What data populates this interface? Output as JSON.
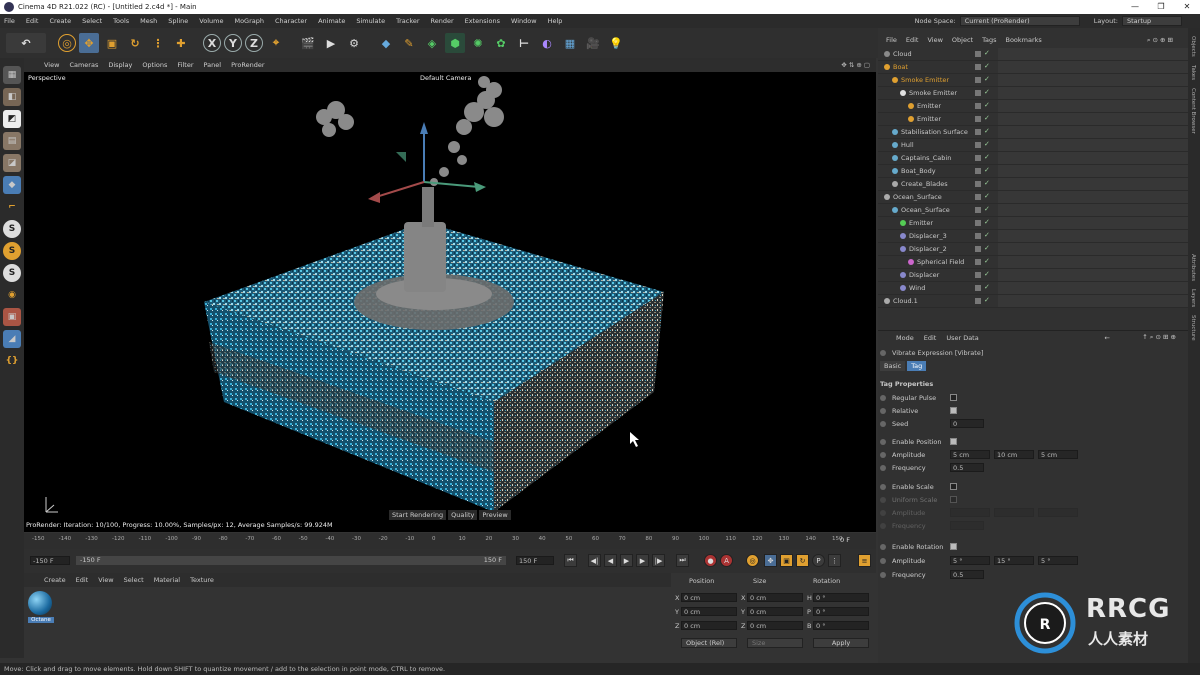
{
  "app": {
    "title": "Cinema 4D R21.022 (RC) - [Untitled 2.c4d *] - Main",
    "window_controls": [
      "—",
      "❐",
      "✕"
    ]
  },
  "menubar": {
    "items": [
      "File",
      "Edit",
      "Create",
      "Select",
      "Tools",
      "Mesh",
      "Spline",
      "Volume",
      "MoGraph",
      "Character",
      "Animate",
      "Simulate",
      "Tracker",
      "Render",
      "Extensions",
      "Window",
      "Help"
    ],
    "node_space_label": "Node Space:",
    "node_space_value": "Current (ProRender)",
    "layout_label": "Layout:",
    "layout_value": "Startup"
  },
  "toolbar": {
    "axis_labels": [
      "X",
      "Y",
      "Z"
    ]
  },
  "viewport": {
    "menu": [
      "View",
      "Cameras",
      "Display",
      "Options",
      "Filter",
      "Panel",
      "ProRender"
    ],
    "label": "Perspective",
    "camera": "Default Camera",
    "status": "ProRender: Iteration: 10/100, Progress: 10.00%, Samples/px: 12, Average Samples/s: 99.924M",
    "buttons": [
      "Start Rendering",
      "Quality",
      "Preview"
    ]
  },
  "timeline": {
    "ticks": [
      "-150",
      "-140",
      "-130",
      "-120",
      "-110",
      "-100",
      "-90",
      "-80",
      "-70",
      "-60",
      "-50",
      "-40",
      "-30",
      "-20",
      "-10",
      "0",
      "10",
      "20",
      "30",
      "40",
      "50",
      "60",
      "70",
      "80",
      "90",
      "100",
      "110",
      "120",
      "130",
      "140",
      "150"
    ],
    "frame_indicator": "0 F",
    "start_field": "-150 F",
    "range_start": "-150 F",
    "range_end": "150 F",
    "end_field": "150 F"
  },
  "material_manager": {
    "menu": [
      "Create",
      "Edit",
      "View",
      "Select",
      "Material",
      "Texture"
    ],
    "material_name": "Octane"
  },
  "coordinates": {
    "headers": [
      "Position",
      "Size",
      "Rotation"
    ],
    "rows": [
      {
        "axis": "X",
        "pos": "0 cm",
        "size_axis": "X",
        "size": "0 cm",
        "rot_axis": "H",
        "rot": "0 °"
      },
      {
        "axis": "Y",
        "pos": "0 cm",
        "size_axis": "Y",
        "size": "0 cm",
        "rot_axis": "P",
        "rot": "0 °"
      },
      {
        "axis": "Z",
        "pos": "0 cm",
        "size_axis": "Z",
        "size": "0 cm",
        "rot_axis": "B",
        "rot": "0 °"
      }
    ],
    "mode": "Object (Rel)",
    "size_mode": "Size",
    "apply": "Apply"
  },
  "object_manager": {
    "menu": [
      "File",
      "Edit",
      "View",
      "Object",
      "Tags",
      "Bookmarks"
    ],
    "objects": [
      {
        "name": "Cloud",
        "indent": 0,
        "color": "#8a8a8a"
      },
      {
        "name": "Boat",
        "indent": 0,
        "color": "#e0a030"
      },
      {
        "name": "Smoke Emitter",
        "indent": 1,
        "color": "#e0a030"
      },
      {
        "name": "Smoke Emitter",
        "indent": 2,
        "color": "#e0e0e0"
      },
      {
        "name": "Emitter",
        "indent": 3,
        "color": "#e0a030"
      },
      {
        "name": "Emitter",
        "indent": 3,
        "color": "#e0a030"
      },
      {
        "name": "Stabilisation Surface",
        "indent": 1,
        "color": "#6ac"
      },
      {
        "name": "Hull",
        "indent": 1,
        "color": "#6ac"
      },
      {
        "name": "Captains_Cabin",
        "indent": 1,
        "color": "#6ac"
      },
      {
        "name": "Boat_Body",
        "indent": 1,
        "color": "#6ac"
      },
      {
        "name": "Create_Blades",
        "indent": 1,
        "color": "#aaa"
      },
      {
        "name": "Ocean_Surface",
        "indent": 0,
        "color": "#aaa"
      },
      {
        "name": "Ocean_Surface",
        "indent": 1,
        "color": "#6ac"
      },
      {
        "name": "Emitter",
        "indent": 2,
        "color": "#5c5"
      },
      {
        "name": "Displacer_3",
        "indent": 2,
        "color": "#88c"
      },
      {
        "name": "Displacer_2",
        "indent": 2,
        "color": "#88c"
      },
      {
        "name": "Spherical Field",
        "indent": 3,
        "color": "#c6c"
      },
      {
        "name": "Displacer",
        "indent": 2,
        "color": "#88c"
      },
      {
        "name": "Wind",
        "indent": 2,
        "color": "#88c"
      },
      {
        "name": "Cloud.1",
        "indent": 0,
        "color": "#aaa"
      }
    ]
  },
  "attributes": {
    "menu": [
      "Mode",
      "Edit",
      "User Data"
    ],
    "title": "Vibrate Expression [Vibrate]",
    "tabs": [
      "Basic",
      "Tag"
    ],
    "section": "Tag Properties",
    "regular_pulse": "Regular Pulse",
    "relative": "Relative",
    "seed_label": "Seed",
    "seed": "0",
    "enable_position": "Enable Position",
    "amplitude_label": "Amplitude",
    "pos_amp": [
      "5 cm",
      "10 cm",
      "5 cm"
    ],
    "frequency_label": "Frequency",
    "pos_freq": "0.5",
    "enable_scale": "Enable Scale",
    "uniform_label": "Uniform Scale",
    "enable_rotation": "Enable Rotation",
    "rot_amp": [
      "5 °",
      "15 °",
      "5 °"
    ],
    "rot_freq": "0.5"
  },
  "side_tabs": [
    "Objects",
    "Takes",
    "Content Browser",
    "Attributes",
    "Layers",
    "Structure"
  ],
  "status_bar": "Move: Click and drag to move elements. Hold down SHIFT to quantize movement / add to the selection in point mode, CTRL to remove.",
  "watermark": {
    "brand": "RRCG",
    "sub": "人人素材"
  },
  "colors": {
    "accent_orange": "#e0a030",
    "viewport_bg": "#000000",
    "water": "#3ab0d8"
  }
}
